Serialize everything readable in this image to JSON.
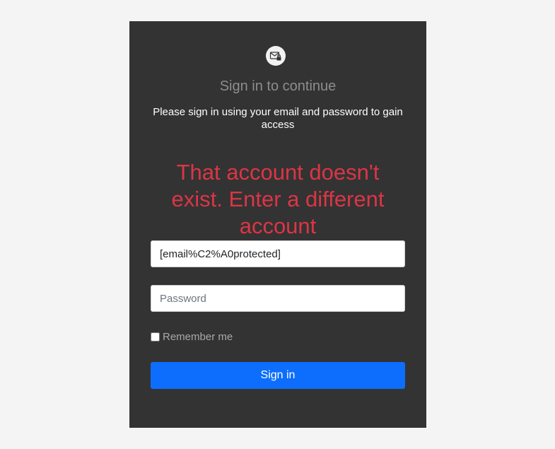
{
  "card": {
    "logo_icon": "mail-lock-icon",
    "title": "Sign in to continue",
    "subtitle": "Please sign in using your email and password to gain access",
    "error": "That account doesn't exist. Enter a different account"
  },
  "form": {
    "email_value": "[email%C2%A0protected]",
    "password_placeholder": "Password",
    "remember_label": "Remember me",
    "remember_checked": false,
    "submit_label": "Sign in"
  },
  "colors": {
    "page_bg": "#f4f4f4",
    "card_bg": "#333333",
    "error": "#dc3545",
    "primary": "#0d6efd"
  }
}
